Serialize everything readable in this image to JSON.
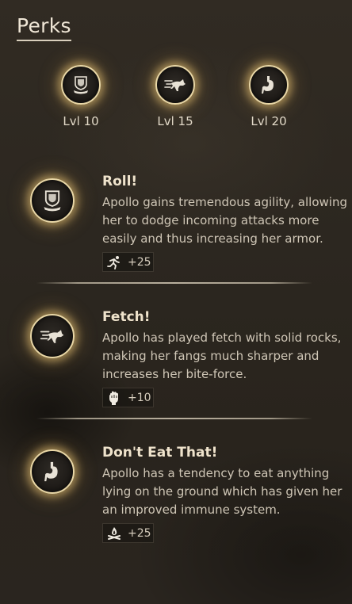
{
  "header": {
    "title": "Perks"
  },
  "tiers": [
    {
      "label": "Lvl 10",
      "icon": "shield-icon"
    },
    {
      "label": "Lvl 15",
      "icon": "running-wolf-icon"
    },
    {
      "label": "Lvl 20",
      "icon": "stomach-icon"
    }
  ],
  "perks": [
    {
      "name": "Roll!",
      "description": "Apollo gains tremendous agility, allowing her to dodge incoming attacks more easily and thus increasing her armor.",
      "bonus": {
        "icon": "sprint-icon",
        "value": "+25"
      }
    },
    {
      "name": "Fetch!",
      "description": "Apollo has played fetch with solid rocks, making her fangs much sharper and increases her bite-force.",
      "bonus": {
        "icon": "fist-icon",
        "value": "+10"
      }
    },
    {
      "name": "Don't Eat That!",
      "description": "Apollo has a tendency to eat anything lying on the ground which has given her an improved immune system.",
      "bonus": {
        "icon": "campfire-icon",
        "value": "+25"
      }
    }
  ],
  "colors": {
    "glow": "#e8c478",
    "ring": "#e9d7a6",
    "text": "#cfc6b6",
    "heading": "#efe3cc"
  }
}
